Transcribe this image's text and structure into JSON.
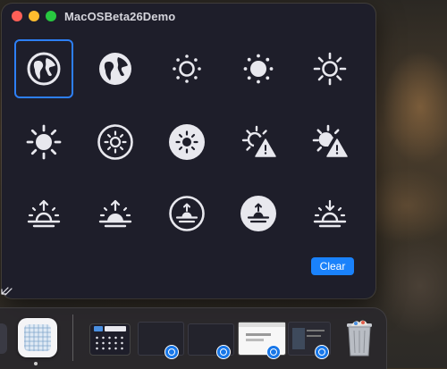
{
  "window": {
    "title": "MacOSBeta26Demo"
  },
  "symbols": [
    {
      "name": "globe-europe-africa-icon",
      "selected": true
    },
    {
      "name": "globe-europe-africa-fill-icon"
    },
    {
      "name": "sun-min-icon"
    },
    {
      "name": "sun-min-fill-icon"
    },
    {
      "name": "sun-max-icon"
    },
    {
      "name": "sun-max-fill-icon"
    },
    {
      "name": "sun-max-circle-icon"
    },
    {
      "name": "sun-max-circle-fill-icon"
    },
    {
      "name": "sun-exclamationmark-icon"
    },
    {
      "name": "sun-exclamationmark-fill-icon"
    },
    {
      "name": "sunrise-icon"
    },
    {
      "name": "sunrise-fill-icon"
    },
    {
      "name": "sunrise-circle-icon"
    },
    {
      "name": "sunrise-circle-fill-icon"
    },
    {
      "name": "sunset-icon"
    }
  ],
  "actions": {
    "clear_label": "Clear"
  },
  "colors": {
    "window_bg": "#1e1e2a",
    "icon": "#e8e8ee",
    "accent": "#1a82fb",
    "selection_border": "#2d7ff5"
  },
  "dock": {
    "items": [
      {
        "name": "dock-app-icon"
      },
      {
        "name": "dock-finder-window-thumbnail"
      },
      {
        "name": "dock-window-thumbnail-1"
      },
      {
        "name": "dock-window-thumbnail-2"
      },
      {
        "name": "dock-window-thumbnail-3"
      },
      {
        "name": "dock-window-thumbnail-4"
      },
      {
        "name": "trash-icon"
      }
    ]
  }
}
